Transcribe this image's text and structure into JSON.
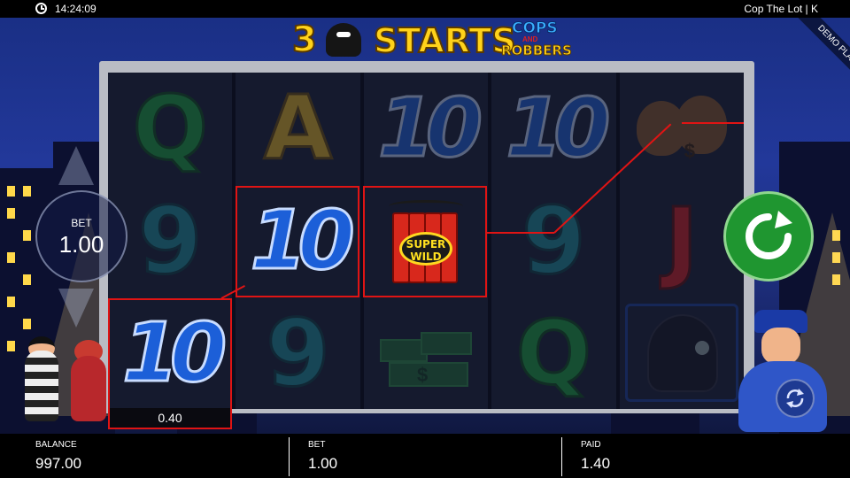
{
  "status_bar": {
    "time": "14:24:09",
    "game_name": "Cop The Lot | K"
  },
  "title": {
    "number": "3",
    "word": "STARTS",
    "brand_top": "COPS",
    "brand_mid": "AND",
    "brand_bottom": "ROBBERS"
  },
  "demo_badge": "DEMO PLAY",
  "bet_control": {
    "label": "BET",
    "value": "1.00"
  },
  "reels": [
    [
      "Q",
      "9",
      "10"
    ],
    [
      "A",
      "10",
      "9"
    ],
    [
      "10",
      "super-wild",
      "cash-stacks"
    ],
    [
      "10",
      "9",
      "Q"
    ],
    [
      "money-bags",
      "J",
      "police-helmet"
    ]
  ],
  "wild_label": {
    "line1": "SUPER",
    "line2": "WILD"
  },
  "win_amount": "0.40",
  "info_bar": {
    "balance_label": "BALANCE",
    "balance_value": "997.00",
    "bet_label": "BET",
    "bet_value": "1.00",
    "paid_label": "PAID",
    "paid_value": "1.40"
  },
  "icons": {
    "spin": "spin-arrow-icon",
    "autoplay": "autoplay-icon",
    "clock": "clock-icon"
  },
  "colors": {
    "spin_green": "#1f9630",
    "win_red": "#e01414",
    "title_yellow": "#ffd21a"
  }
}
